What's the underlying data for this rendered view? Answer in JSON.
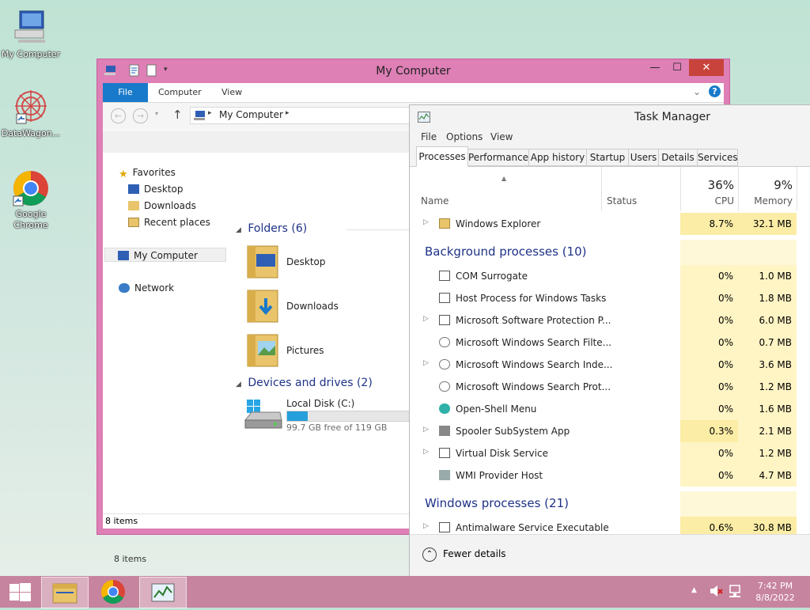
{
  "desktop": {
    "icons": [
      {
        "label": "My Computer"
      },
      {
        "label": "DataWagon..."
      },
      {
        "label": "Google Chrome"
      }
    ]
  },
  "explorer": {
    "title": "My Computer",
    "ribbon_tabs": [
      "File",
      "Computer",
      "View"
    ],
    "address": "My Computer",
    "nav": {
      "favorites": "Favorites",
      "desktop": "Desktop",
      "downloads": "Downloads",
      "recent": "Recent places",
      "mycomputer": "My Computer",
      "network": "Network"
    },
    "folders_header": "Folders (6)",
    "folders": [
      "Desktop",
      "Downloads",
      "Pictures"
    ],
    "devices_header": "Devices and drives (2)",
    "drive": {
      "name": "Local Disk (C:)",
      "free": "99.7 GB free of 119 GB",
      "used_fraction": 0.16
    },
    "items_count_pane": "8 items",
    "items_count_status": "8 items"
  },
  "taskmanager": {
    "title": "Task Manager",
    "menu": [
      "File",
      "Options",
      "View"
    ],
    "tabs": [
      "Processes",
      "Performance",
      "App history",
      "Startup",
      "Users",
      "Details",
      "Services"
    ],
    "columns": {
      "name": "Name",
      "status": "Status",
      "cpu_pct": "36%",
      "cpu": "CPU",
      "mem_pct": "9%",
      "mem": "Memory"
    },
    "apps": [
      {
        "name": "Windows Explorer",
        "cpu": "8.7%",
        "mem": "32.1 MB",
        "expandable": true
      }
    ],
    "background_header": "Background processes (10)",
    "background": [
      {
        "name": "COM Surrogate",
        "cpu": "0%",
        "mem": "1.0 MB",
        "expandable": false
      },
      {
        "name": "Host Process for Windows Tasks",
        "cpu": "0%",
        "mem": "1.8 MB",
        "expandable": false
      },
      {
        "name": "Microsoft Software Protection P...",
        "cpu": "0%",
        "mem": "6.0 MB",
        "expandable": true
      },
      {
        "name": "Microsoft Windows Search Filte...",
        "cpu": "0%",
        "mem": "0.7 MB",
        "expandable": false
      },
      {
        "name": "Microsoft Windows Search Inde...",
        "cpu": "0%",
        "mem": "3.6 MB",
        "expandable": true
      },
      {
        "name": "Microsoft Windows Search Prot...",
        "cpu": "0%",
        "mem": "1.2 MB",
        "expandable": false
      },
      {
        "name": "Open-Shell Menu",
        "cpu": "0%",
        "mem": "1.6 MB",
        "expandable": false
      },
      {
        "name": "Spooler SubSystem App",
        "cpu": "0.3%",
        "mem": "2.1 MB",
        "expandable": true
      },
      {
        "name": "Virtual Disk Service",
        "cpu": "0%",
        "mem": "1.2 MB",
        "expandable": true
      },
      {
        "name": "WMI Provider Host",
        "cpu": "0%",
        "mem": "4.7 MB",
        "expandable": false
      }
    ],
    "windows_header": "Windows processes (21)",
    "windows": [
      {
        "name": "Antimalware Service Executable",
        "cpu": "0.6%",
        "mem": "30.8 MB",
        "expandable": true
      }
    ],
    "fewer_details": "Fewer details"
  },
  "taskbar": {
    "time": "7:42 PM",
    "date": "8/8/2022"
  }
}
